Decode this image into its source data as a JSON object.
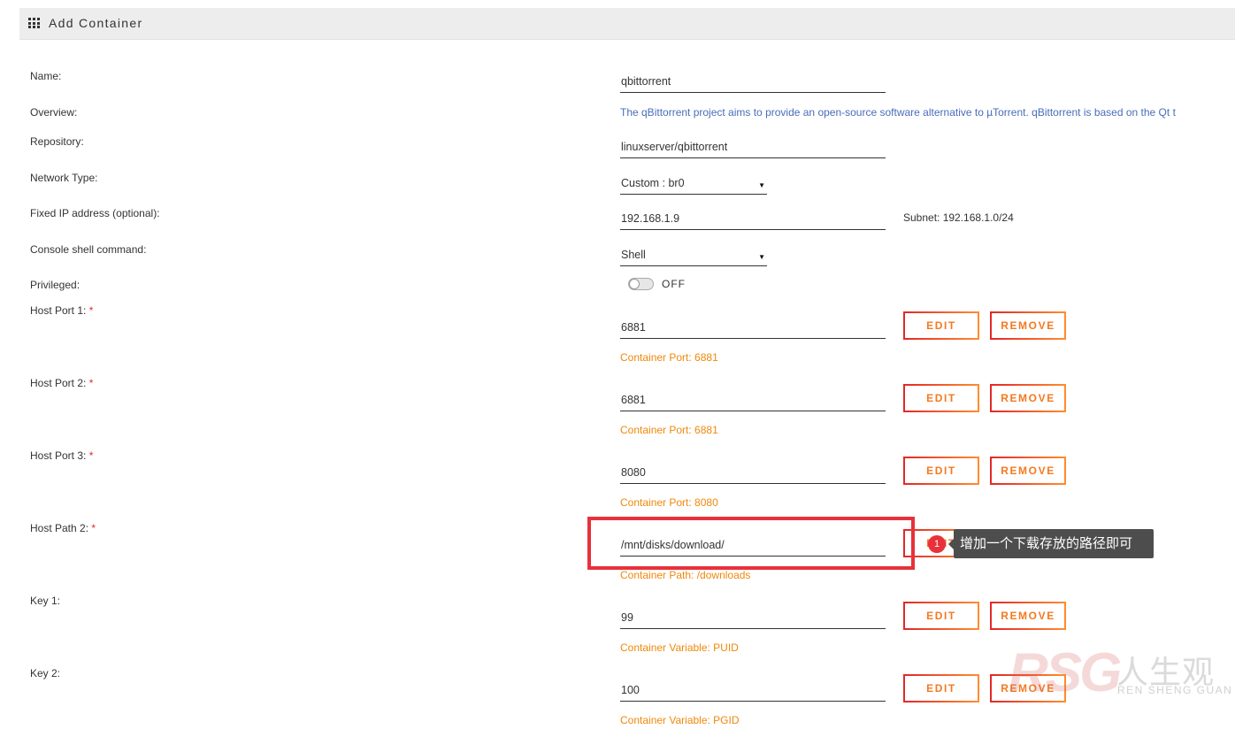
{
  "header": {
    "title": "Add Container",
    "icon": "grid-icon"
  },
  "fields": {
    "name": {
      "label": "Name:",
      "value": "qbittorrent"
    },
    "overview": {
      "label": "Overview:",
      "value": "The qBittorrent project aims to provide an open-source software alternative to µTorrent. qBittorrent is based on the Qt t"
    },
    "repository": {
      "label": "Repository:",
      "value": "linuxserver/qbittorrent"
    },
    "network_type": {
      "label": "Network Type:",
      "value": "Custom : br0"
    },
    "fixed_ip": {
      "label": "Fixed IP address (optional):",
      "value": "192.168.1.9",
      "subnet": "Subnet: 192.168.1.0/24"
    },
    "console_shell": {
      "label": "Console shell command:",
      "value": "Shell"
    },
    "privileged": {
      "label": "Privileged:",
      "state": "OFF"
    }
  },
  "required_mark": "*",
  "configs": [
    {
      "label": "Host Port 1:",
      "value": "6881",
      "info": "Container Port: 6881"
    },
    {
      "label": "Host Port 2:",
      "value": "6881",
      "info": "Container Port: 6881"
    },
    {
      "label": "Host Port 3:",
      "value": "8080",
      "info": "Container Port: 8080"
    },
    {
      "label": "Host Path 2:",
      "value": "/mnt/disks/download/",
      "info": "Container Path: /downloads"
    },
    {
      "label": "Key 1:",
      "value": "99",
      "info": "Container Variable: PUID"
    },
    {
      "label": "Key 2:",
      "value": "100",
      "info": "Container Variable: PGID"
    }
  ],
  "buttons": {
    "edit": "EDIT",
    "remove": "REMOVE"
  },
  "annotation": {
    "step": "1",
    "tooltip": "增加一个下载存放的路径即可"
  },
  "watermark": {
    "logo": "RSG",
    "cn": "人生观",
    "en": "REN SHENG GUAN"
  },
  "colors": {
    "accent_orange": "#f0880a",
    "button_red": "#e22828",
    "overview_blue": "#486dba",
    "highlight_red": "#e8313a"
  }
}
